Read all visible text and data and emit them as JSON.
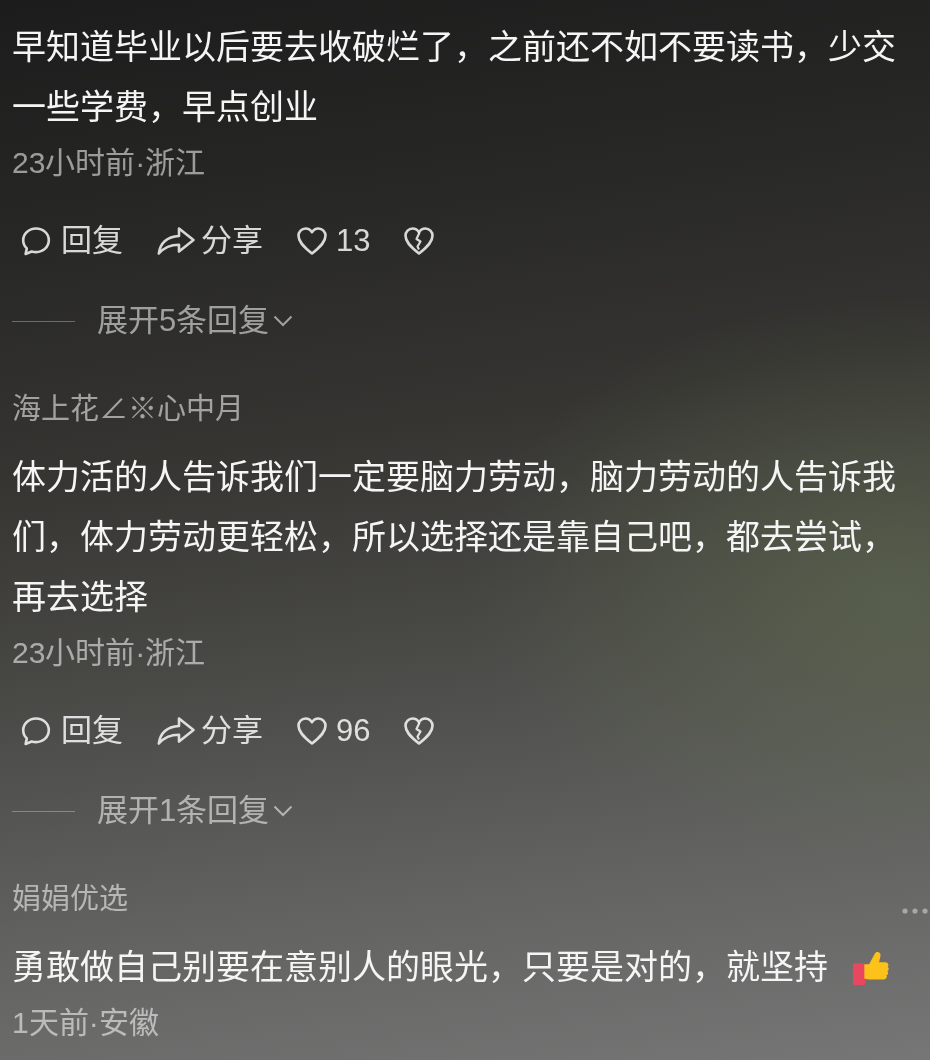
{
  "comments": [
    {
      "text": "早知道毕业以后要去收破烂了，之前还不如不要读书，少交一些学费，早点创业",
      "meta": "23小时前·浙江",
      "actions": {
        "reply": "回复",
        "share": "分享",
        "likes": "13",
        "liked": false
      },
      "expand": "展开5条回复"
    },
    {
      "username": "海上花∠※心中月",
      "more_icon": false,
      "text": "体力活的人告诉我们一定要脑力劳动，脑力劳动的人告诉我们，体力劳动更轻松，所以选择还是靠自己吧，都去尝试，再去选择",
      "meta": "23小时前·浙江",
      "actions": {
        "reply": "回复",
        "share": "分享",
        "likes": "96",
        "liked": false
      },
      "expand": "展开1条回复"
    },
    {
      "username": "娟娟优选",
      "more_icon": true,
      "text": "勇敢做自己别要在意别人的眼光，只要是对的，就坚持",
      "emoji_after_text": true,
      "meta": "1天前·安徽"
    }
  ]
}
